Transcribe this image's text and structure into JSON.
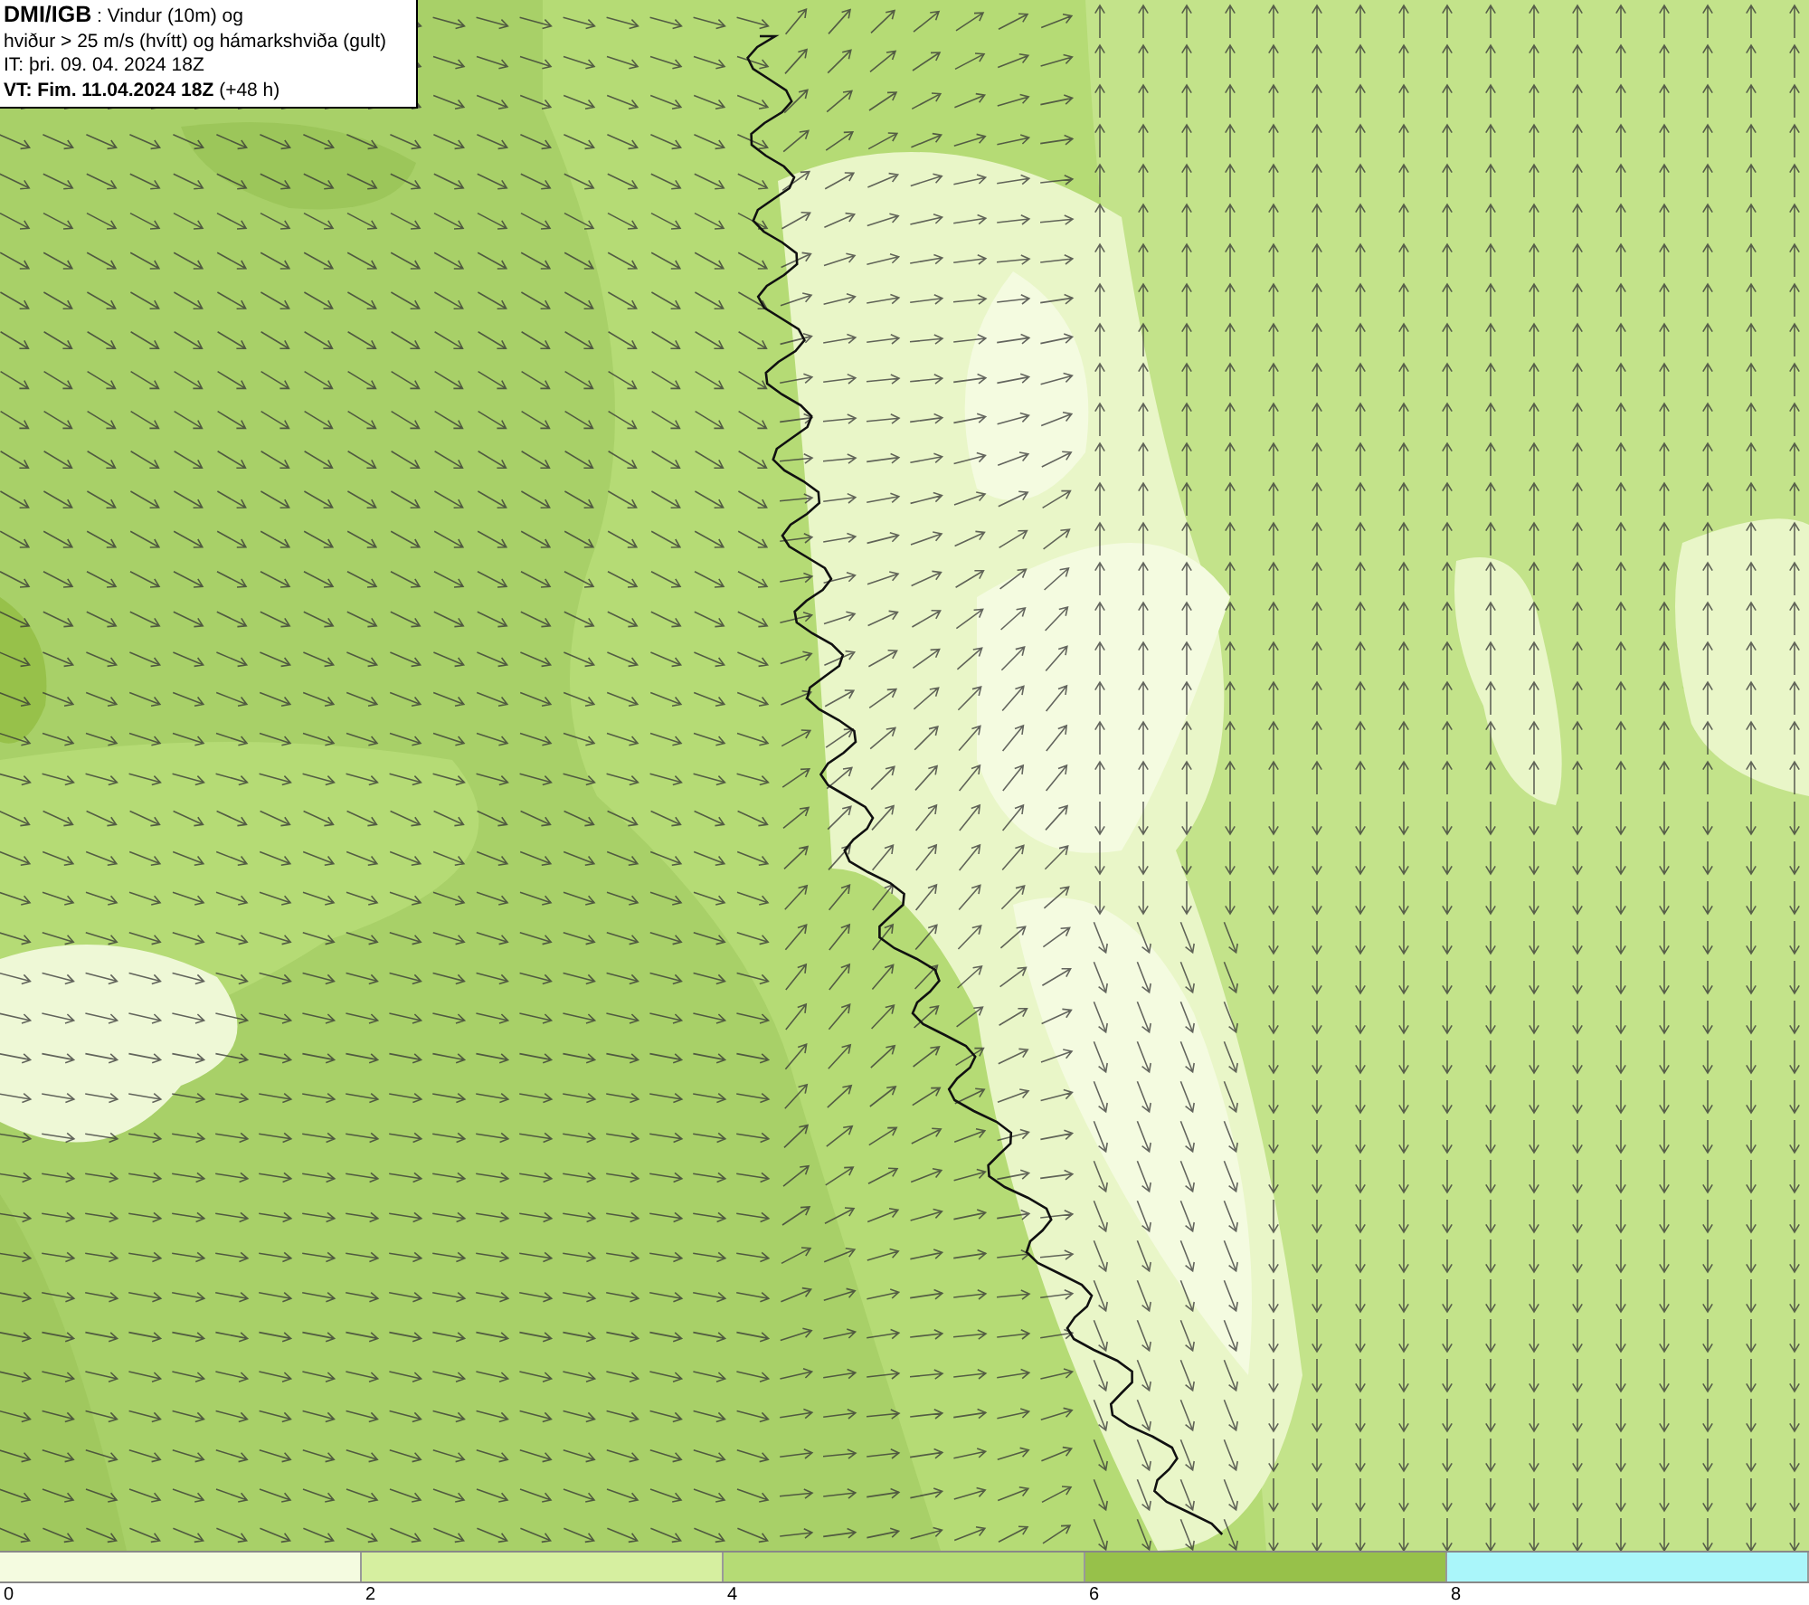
{
  "title_box": {
    "lines": [
      "**DMI/IGB** : Vindur (10m) og",
      "hviður > 25 m/s (hvítt) og hámarkshviða (gult)",
      "IT: þri. 09. 04. 2024 18Z",
      "**VT: Fim. 11.04.2024 18Z** (+48 h)"
    ]
  },
  "legend": {
    "bands": [
      {
        "color": "#f4fbe0",
        "label": "0"
      },
      {
        "color": "#d6efa0",
        "label": "2"
      },
      {
        "color": "#b5db75",
        "label": "4"
      },
      {
        "color": "#97c14a",
        "label": "6"
      },
      {
        "color": "#aaf6fa",
        "label": "8"
      }
    ]
  }
}
